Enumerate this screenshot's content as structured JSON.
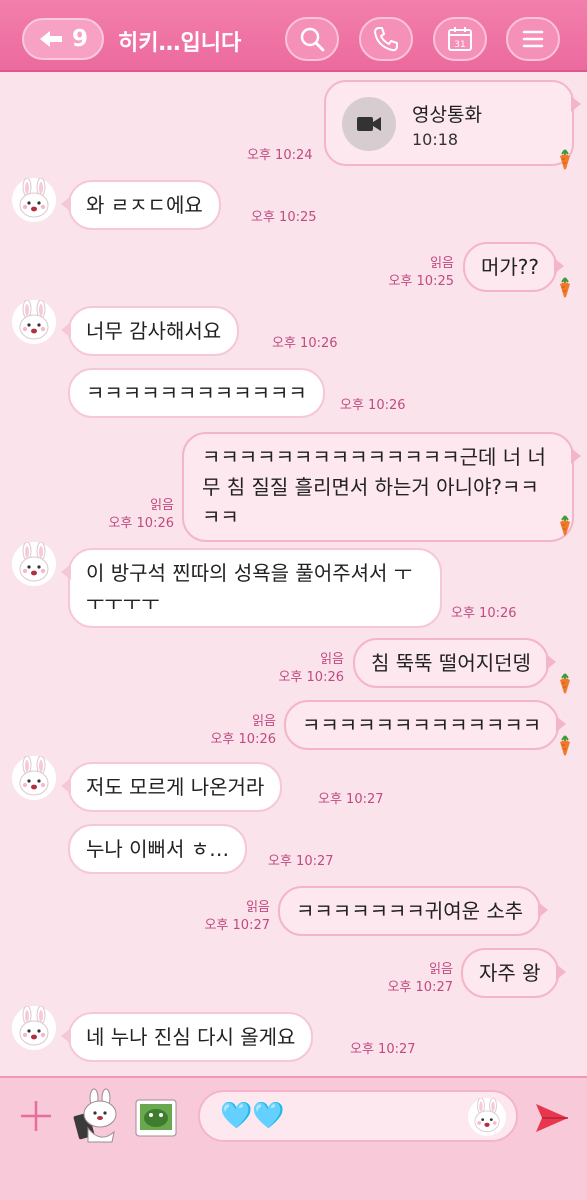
{
  "header": {
    "back_count": "9",
    "title": "히키…입니다",
    "icons": [
      "back-arrow-icon",
      "search-icon",
      "phone-icon",
      "calendar-icon",
      "menu-icon"
    ],
    "calendar_day": "31"
  },
  "messages": {
    "video_call": {
      "title": "영상통화",
      "duration": "10:18",
      "time": "오후 10:24"
    },
    "m1": {
      "text": "와 ㄹㅈㄷ에요",
      "time": "오후 10:25"
    },
    "m2": {
      "text": "머가??",
      "read": "읽음",
      "time": "오후 10:25"
    },
    "m3": {
      "text": "너무 감사해서요",
      "time": "오후 10:26"
    },
    "m4": {
      "text": "ㅋㅋㅋㅋㅋㅋㅋㅋㅋㅋㅋㅋ",
      "time": "오후 10:26"
    },
    "m5": {
      "text": "ㅋㅋㅋㅋㅋㅋㅋㅋㅋㅋㅋㅋㅋㅋ근데 너 너무 침 질질 흘리면서 하는거 아니야?ㅋㅋㅋㅋ",
      "read": "읽음",
      "time": "오후 10:26"
    },
    "m6": {
      "text": "이 방구석 찐따의 성욕을 풀어주셔서 ㅜㅜㅜㅜㅜ",
      "time": "오후 10:26"
    },
    "m7": {
      "text": "침 뚝뚝 떨어지던뎅",
      "read": "읽음",
      "time": "오후 10:26"
    },
    "m8": {
      "text": "ㅋㅋㅋㅋㅋㅋㅋㅋㅋㅋㅋㅋㅋ",
      "read": "읽음",
      "time": "오후 10:26"
    },
    "m9": {
      "text": "저도 모르게 나온거라",
      "time": "오후 10:27"
    },
    "m10": {
      "text": "누나 이뻐서 ㅎ…",
      "time": "오후 10:27"
    },
    "m11": {
      "text": "ㅋㅋㅋㅋㅋㅋㅋ귀여운 소추",
      "read": "읽음",
      "time": "오후 10:27"
    },
    "m12": {
      "text": "자주 왕",
      "read": "읽음",
      "time": "오후 10:27"
    },
    "m13": {
      "text": "네 누나 진심 다시 올게요",
      "time": "오후 10:27"
    }
  },
  "input": {
    "value": "🩵🩵",
    "icons": [
      "plus-icon",
      "sticker-icon",
      "photo-icon",
      "emoji-icon",
      "send-icon"
    ]
  },
  "colors": {
    "header": "#ec6a9e",
    "background": "#fbe3ec",
    "accent": "#c14a80",
    "send": "#e8364f"
  }
}
